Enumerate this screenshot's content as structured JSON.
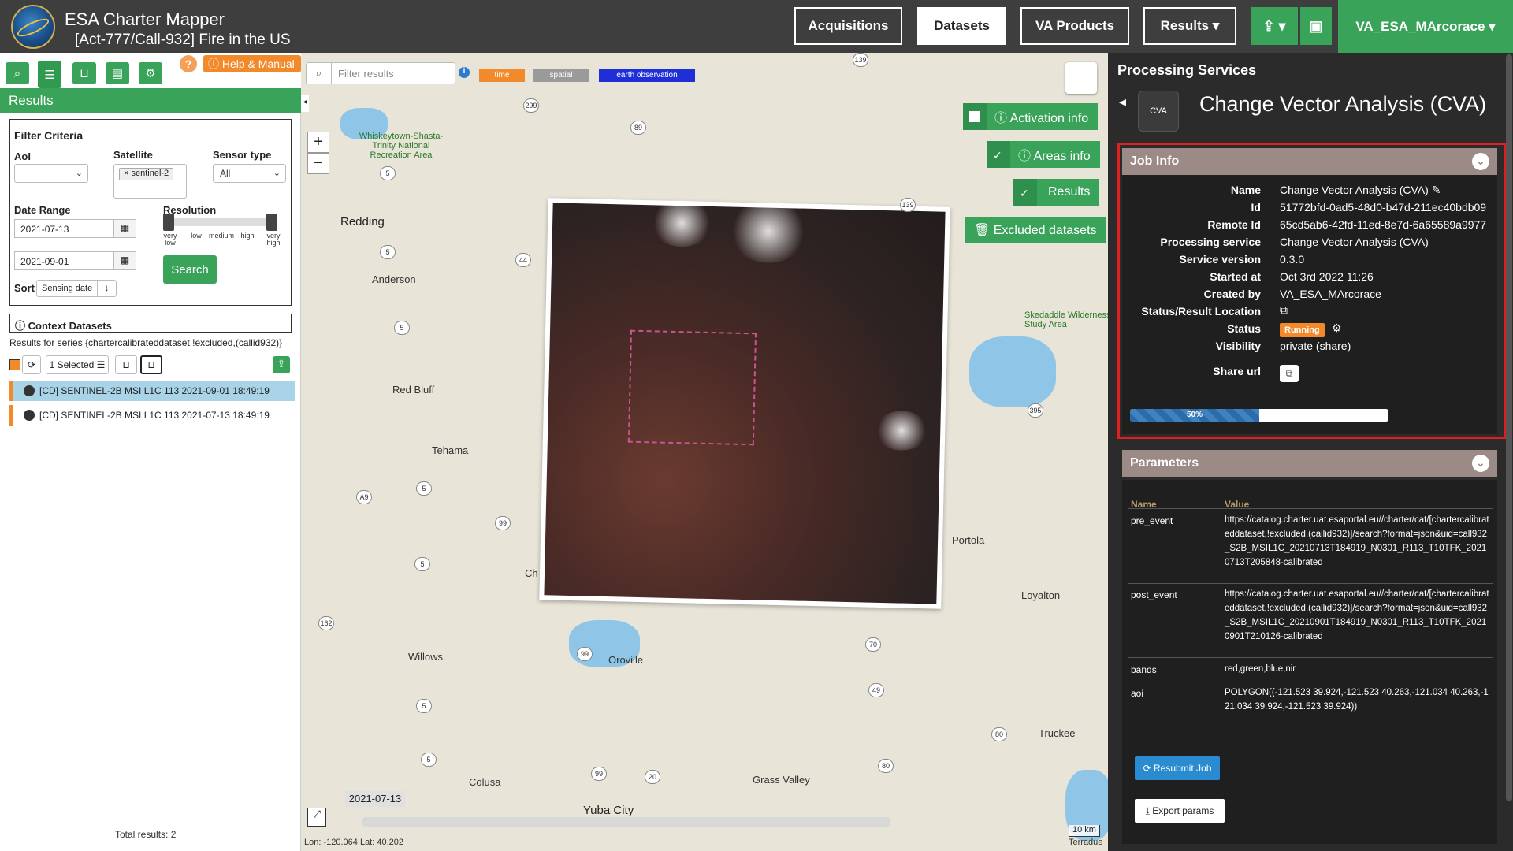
{
  "header": {
    "app_title": "ESA Charter Mapper",
    "subtitle": "[Act-777/Call-932] Fire in the US",
    "nav": [
      "Acquisitions",
      "Datasets",
      "VA Products",
      "Results ▾"
    ],
    "upload_icon": "⇪ ▾",
    "briefcase_icon": "▣",
    "user": "VA_ESA_MArcorace ▾"
  },
  "left": {
    "help_label": "ⓘ Help & Manual",
    "help_q": "?",
    "results_title": "Results",
    "filter": {
      "title": "Filter Criteria",
      "aoi_label": "AoI",
      "aoi_value": "",
      "satellite_label": "Satellite",
      "satellite_tag": "× sentinel-2",
      "sensor_label": "Sensor type",
      "sensor_value": "All",
      "date_range_label": "Date Range",
      "date_from": "2021-07-13",
      "date_to": "2021-09-01",
      "resolution_label": "Resolution",
      "resolution_ticks": [
        "very low",
        "low",
        "medium",
        "high",
        "very high"
      ],
      "search_label": "Search",
      "sort_label": "Sort",
      "sort_value": "Sensing date"
    },
    "context_title": "ⓘ Context Datasets",
    "series_text": "Results for series {chartercalibrateddataset,!excluded,(callid932)}",
    "selected_label": "1 Selected ☰",
    "results": [
      "[CD] SENTINEL-2B MSI L1C 113 2021-09-01 18:49:19",
      "[CD] SENTINEL-2B MSI L1C 113 2021-07-13 18:49:19"
    ],
    "total": "Total results: 2"
  },
  "map": {
    "filter_placeholder": "Filter results",
    "chips": [
      {
        "label": "time",
        "color": "#f28a2c"
      },
      {
        "label": "spatial",
        "color": "#9a9a9a"
      },
      {
        "label": "earth observation",
        "color": "#1e2fd8"
      }
    ],
    "overlay_buttons": [
      "ⓘ Activation info",
      "ⓘ Areas info",
      "Results",
      "🗑 Excluded datasets"
    ],
    "timeline_date": "2021-07-13",
    "scale": "10 km",
    "coords": "Lon: -120.064 Lat: 40.202",
    "attribution": "Terradue",
    "cities": [
      "Redding",
      "Anderson",
      "Red Bluff",
      "Tehama",
      "Willows",
      "Oroville",
      "Colusa",
      "Yuba City",
      "Grass Valley",
      "Truckee",
      "Loyalton",
      "Portola",
      "Whiskeytown-Shasta-Trinity National Recreation Area",
      "Skedaddle Wilderness Study Area",
      "Ch"
    ],
    "highways": [
      "139",
      "299",
      "89",
      "139",
      "44",
      "5",
      "5",
      "5",
      "395",
      "A9",
      "5",
      "99",
      "5",
      "162",
      "99",
      "70",
      "49",
      "5",
      "5",
      "99",
      "20",
      "80",
      "80",
      "395",
      "89",
      "49"
    ]
  },
  "right": {
    "panel_title": "Processing Services",
    "service_abbr": "CVA",
    "service_name": "Change Vector Analysis (CVA)",
    "job_info_title": "Job Info",
    "job": [
      {
        "k": "Name",
        "v": "Change Vector Analysis (CVA) ✎"
      },
      {
        "k": "Id",
        "v": "51772bfd-0ad5-48d0-b47d-211ec40bdb09"
      },
      {
        "k": "Remote Id",
        "v": "65cd5ab6-42fd-11ed-8e7d-6a65589a9977"
      },
      {
        "k": "Processing service",
        "v": "Change Vector Analysis (CVA)"
      },
      {
        "k": "Service version",
        "v": "0.3.0"
      },
      {
        "k": "Started at",
        "v": "Oct 3rd 2022 11:26"
      },
      {
        "k": "Created by",
        "v": "VA_ESA_MArcorace"
      },
      {
        "k": "Status/Result Location",
        "v": "⧉"
      },
      {
        "k": "Status",
        "v": ""
      },
      {
        "k": "Visibility",
        "v": "private (share)"
      },
      {
        "k": "Share url",
        "v": ""
      }
    ],
    "status_badge": "Running",
    "progress": {
      "percent": 50,
      "label": "50%"
    },
    "params_title": "Parameters",
    "params_headers": [
      "Name",
      "Value"
    ],
    "params": [
      {
        "name": "pre_event",
        "value": "https://catalog.charter.uat.esaportal.eu//charter/cat/[chartercalibrateddataset,!excluded,(callid932)]/search?format=json&uid=call932_S2B_MSIL1C_20210713T184919_N0301_R113_T10TFK_20210713T205848-calibrated"
      },
      {
        "name": "post_event",
        "value": "https://catalog.charter.uat.esaportal.eu//charter/cat/[chartercalibrateddataset,!excluded,(callid932)]/search?format=json&uid=call932_S2B_MSIL1C_20210901T184919_N0301_R113_T10TFK_20210901T210126-calibrated"
      },
      {
        "name": "bands",
        "value": "red,green,blue,nir"
      },
      {
        "name": "aoi",
        "value": "POLYGON((-121.523 39.924,-121.523 40.263,-121.034 40.263,-121.034 39.924,-121.523 39.924))"
      }
    ],
    "resubmit_label": "⟳ Resubmit Job",
    "export_label": "⤓ Export params"
  }
}
